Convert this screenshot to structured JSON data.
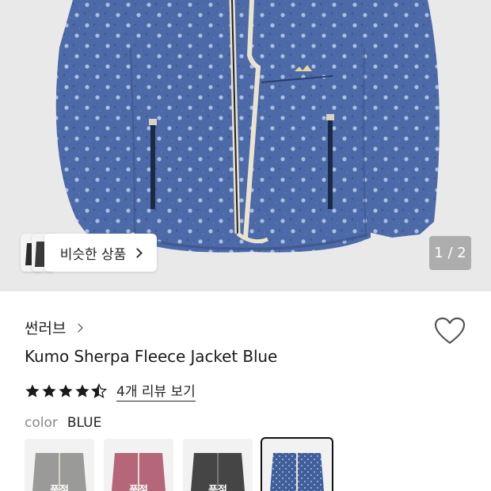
{
  "gallery": {
    "similar_label": "비슷한 상품",
    "page_indicator": "1 / 2"
  },
  "product": {
    "brand": "썬러브",
    "title": "Kumo Sherpa Fleece Jacket Blue",
    "rating": 4.5,
    "review_link": "4개 리뷰 보기",
    "color_label": "color",
    "color_value": "BLUE"
  },
  "swatches": [
    {
      "name": "grey",
      "color": "#9a9b98",
      "tag": "품절"
    },
    {
      "name": "pink",
      "color": "#b56679",
      "tag": "품절"
    },
    {
      "name": "black",
      "color": "#454545",
      "tag": "품절"
    },
    {
      "name": "blue",
      "color": "#3f5e9a",
      "tag": ""
    }
  ],
  "colors": {
    "jacket": "#4c69a8",
    "dot": "#a9bfe2",
    "trim": "#ece3cf",
    "background": "#e9e9e9"
  }
}
